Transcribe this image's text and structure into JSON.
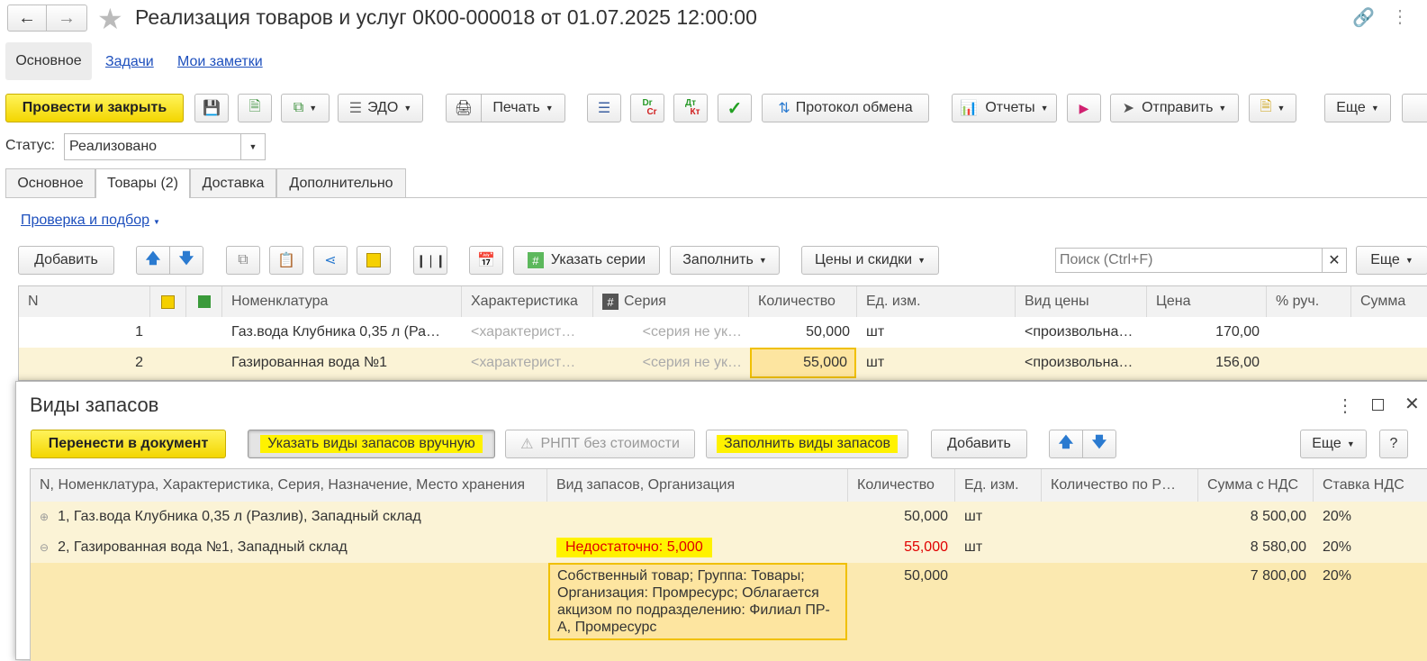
{
  "window": {
    "title": "Реализация товаров и услуг 0К00-000018 от 01.07.2025 12:00:00",
    "nav_tabs": [
      "Основное",
      "Задачи",
      "Мои заметки"
    ]
  },
  "toolbar": {
    "post_close": "Провести и закрыть",
    "edo": "ЭДО",
    "print": "Печать",
    "protocol": "Протокол обмена",
    "reports": "Отчеты",
    "send": "Отправить",
    "more": "Еще",
    "dr_top": "Dr",
    "dr_bottom": "Cr",
    "dt_top": "Дт",
    "dt_bottom": "Кт"
  },
  "status": {
    "label": "Статус:",
    "value": "Реализовано"
  },
  "tabs": [
    "Основное",
    "Товары (2)",
    "Доставка",
    "Дополнительно"
  ],
  "goods": {
    "check_link": "Проверка и подбор",
    "add": "Добавить",
    "series_btn": "Указать серии",
    "fill_btn": "Заполнить",
    "prices_btn": "Цены и скидки",
    "search_placeholder": "Поиск (Ctrl+F)",
    "more": "Еще",
    "columns": [
      "N",
      "Номенклатура",
      "Характеристика",
      "Серия",
      "Количество",
      "Ед. изм.",
      "Вид цены",
      "Цена",
      "% руч.",
      "Сумма"
    ],
    "rows": [
      {
        "n": "1",
        "name": "Газ.вода Клубника 0,35 л (Ра…",
        "char": "<характерист…",
        "series": "<серия не ук…",
        "qty": "50,000",
        "unit": "шт",
        "price_type": "<произвольна…",
        "price": "170,00"
      },
      {
        "n": "2",
        "name": "Газированная вода №1",
        "char": "<характерист…",
        "series": "<серия не ук…",
        "qty": "55,000",
        "unit": "шт",
        "price_type": "<произвольна…",
        "price": "156,00"
      }
    ]
  },
  "stock": {
    "title": "Виды запасов",
    "transfer_btn": "Перенести в документ",
    "manual_btn": "Указать виды запасов вручную",
    "rnpt_btn": "РНПТ без стоимости",
    "fill_btn": "Заполнить виды запасов",
    "add_btn": "Добавить",
    "more": "Еще",
    "help": "?",
    "columns": [
      "N, Номенклатура, Характеристика, Серия, Назначение, Место хранения",
      "Вид запасов, Организация",
      "Количество",
      "Ед. изм.",
      "Количество по Р…",
      "Сумма с НДС",
      "Ставка НДС"
    ],
    "rows": [
      {
        "name": "1, Газ.вода Клубника 0,35 л (Разлив), Западный склад",
        "kind": "",
        "qty": "50,000",
        "unit": "шт",
        "sum": "8 500,00",
        "vat": "20%"
      },
      {
        "name": "2, Газированная вода №1, Западный склад",
        "kind": "Недостаточно: 5,000",
        "qty": "55,000",
        "unit": "шт",
        "sum": "8 580,00",
        "vat": "20%"
      },
      {
        "name": "",
        "kind": "Собственный товар; Группа: Товары; Организация: Промресурс; Облагается акцизом по подразделению: Филиал ПР-А, Промресурс",
        "qty": "50,000",
        "unit": "",
        "sum": "7 800,00",
        "vat": "20%"
      }
    ]
  },
  "colors": {
    "accent_yellow": "#f5dc00",
    "row_selected": "#fbf3d6",
    "error_red": "#e00000",
    "link_blue": "#1d4fbd"
  }
}
